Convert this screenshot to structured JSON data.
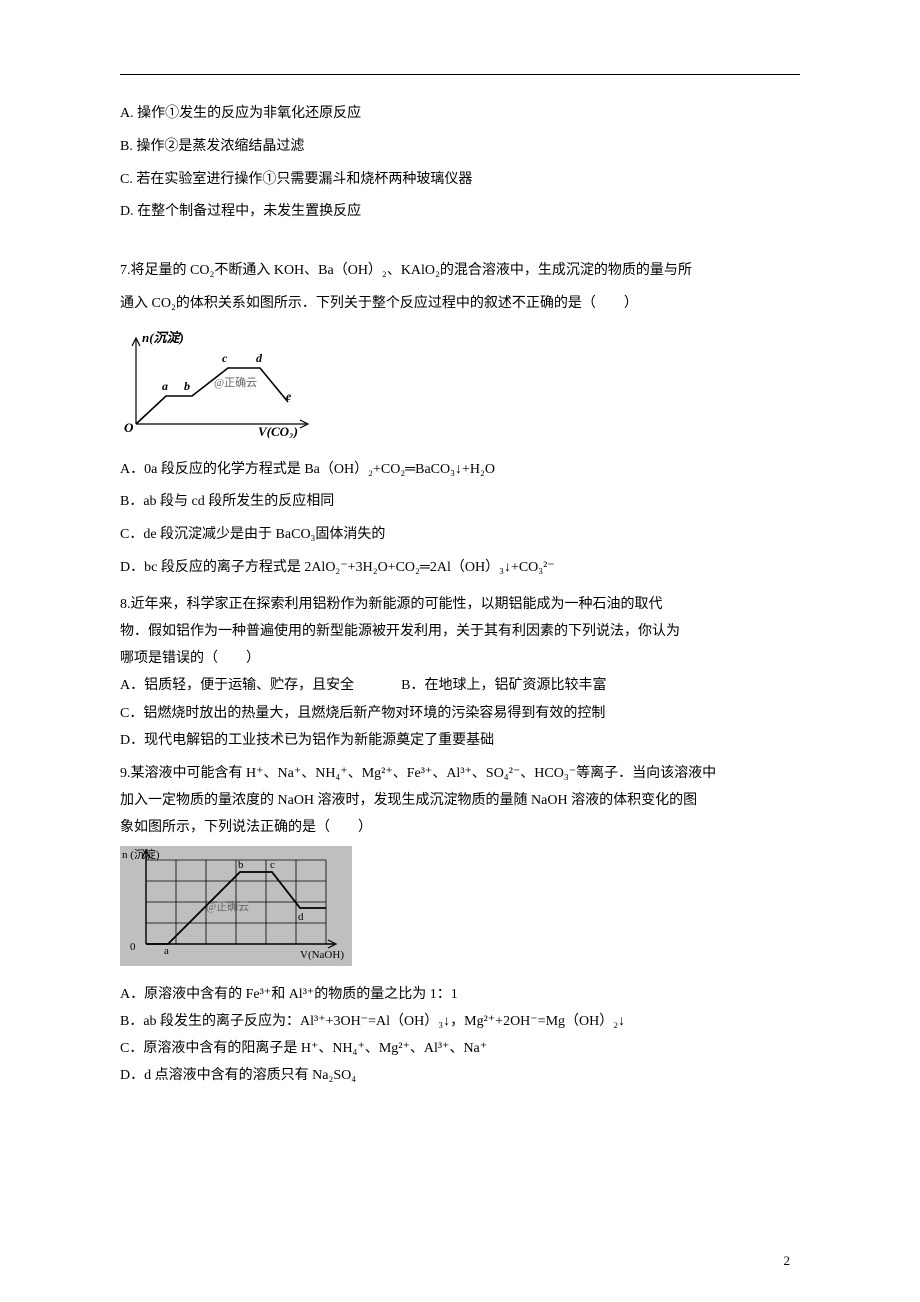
{
  "q6": {
    "optA": "A. 操作①发生的反应为非氧化还原反应",
    "optB": "B. 操作②是蒸发浓缩结晶过滤",
    "optC": "C. 若在实验室进行操作①只需要漏斗和烧杯两种玻璃仪器",
    "optD": "D. 在整个制备过程中，未发生置换反应"
  },
  "q7": {
    "stem1": "7.将足量的 CO₂不断通入 KOH、Ba（OH）₂、KAlO₂的混合溶液中，生成沉淀的物质的量与所",
    "stem2": "通入 CO₂的体积关系如图所示．下列关于整个反应过程中的叙述不正确的是（　　）",
    "fig_ylabel": "n(沉淀)",
    "fig_watermark": "@正确云",
    "fig_xlabel": "V(CO₂)",
    "optA": "A．0a 段反应的化学方程式是 Ba（OH）₂+CO₂═BaCO₃↓+H₂O",
    "optB": "B．ab 段与 cd 段所发生的反应相同",
    "optC": "C．de 段沉淀减少是由于 BaCO₃固体消失的",
    "optD": "D．bc 段反应的离子方程式是 2AlO₂⁻+3H₂O+CO₂═2Al（OH）₃↓+CO₃²⁻"
  },
  "q8": {
    "stem1": "8.近年来，科学家正在探索利用铝粉作为新能源的可能性，以期铝能成为一种石油的取代",
    "stem2": "物．假如铝作为一种普遍使用的新型能源被开发利用，关于其有利因素的下列说法，你认为",
    "stem3": "哪项是错误的（　　）",
    "optA": "A．铝质轻，便于运输、贮存，且安全",
    "optB": "B．在地球上，铝矿资源比较丰富",
    "optC": "C．铝燃烧时放出的热量大，且燃烧后新产物对环境的污染容易得到有效的控制",
    "optD": "D．现代电解铝的工业技术已为铝作为新能源奠定了重要基础"
  },
  "q9": {
    "stem1": "9.某溶液中可能含有 H⁺、Na⁺、NH₄⁺、Mg²⁺、Fe³⁺、Al³⁺、SO₄²⁻、HCO₃⁻等离子．当向该溶液中",
    "stem2": "加入一定物质的量浓度的 NaOH 溶液时，发现生成沉淀物质的量随 NaOH 溶液的体积变化的图",
    "stem3": "象如图所示，下列说法正确的是（　　）",
    "fig_ylabel": "n (沉淀)",
    "fig_xlabel": "V(NaOH)",
    "fig_watermark": "@正确云",
    "optA": "A．原溶液中含有的 Fe³⁺和 Al³⁺的物质的量之比为 1：1",
    "optB": "B．ab 段发生的离子反应为：Al³⁺+3OH⁻=Al（OH）₃↓，Mg²⁺+2OH⁻=Mg（OH）₂↓",
    "optC": "C．原溶液中含有的阳离子是 H⁺、NH₄⁺、Mg²⁺、Al³⁺、Na⁺",
    "optD": "D．d 点溶液中含有的溶质只有 Na₂SO₄"
  },
  "pageNum": "2"
}
